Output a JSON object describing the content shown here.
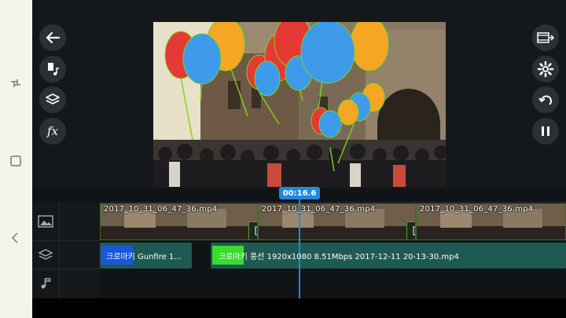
{
  "system_nav": {
    "recents_icon": "recents-icon",
    "home_icon": "home-icon",
    "back_icon": "back-icon"
  },
  "editor": {
    "fx_label": "fx",
    "playhead_time": "00:16.6"
  },
  "timeline": {
    "video_clips": [
      {
        "label": "2017_10_31_06_47_36.mp4"
      },
      {
        "label": "2017_10_31_06_47_36.mp4"
      },
      {
        "label": "2017_10_31_06_47_36.mp4"
      }
    ],
    "layers": [
      {
        "label": "크로마키 Gunfire 1..."
      },
      {
        "label": "크로마키 풍선 1920x1080 8.51Mbps 2017-12-11 20-13-30.mp4"
      }
    ]
  },
  "colors": {
    "accent": "#1e88e5",
    "panel": "#15181b",
    "clip_border": "#3d6b2e",
    "layer": "#1e5a52"
  }
}
